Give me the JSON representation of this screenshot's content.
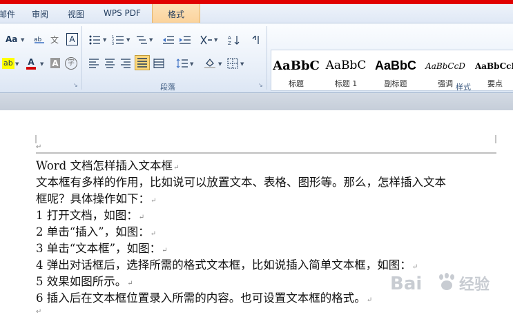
{
  "tabs": [
    "邮件",
    "审阅",
    "视图",
    "WPS PDF",
    "格式"
  ],
  "font_group": {
    "change_case_label": "Aa",
    "char_border_label": "A",
    "highlight_label": "ab",
    "font_color_label": "A",
    "shading_label": "A",
    "enclose_char_label": "字"
  },
  "paragraph_group": {
    "label": "段落",
    "active_alignment": "justify"
  },
  "styles_group": {
    "label": "样式",
    "items": [
      {
        "preview": "AaBbC",
        "name": "标题"
      },
      {
        "preview": "AaBbC",
        "name": "标题 1"
      },
      {
        "preview": "AaBbC",
        "name": "副标题"
      },
      {
        "preview": "AaBbCcD",
        "name": "强调"
      },
      {
        "preview": "AaBbCcI",
        "name": "要点"
      }
    ]
  },
  "document": {
    "header_mark": "↵",
    "lines": [
      "Word 文档怎样插入文本框",
      "文本框有多样的作用，比如说可以放置文本、表格、图形等。那么，怎样插入文本",
      "框呢？具体操作如下：",
      "1 打开文档，如图：",
      "2 单击“插入”，如图：",
      "3 单击“文本框”，如图：",
      "4 弹出对话框后，选择所需的格式文本框，比如说插入简单文本框，如图：",
      "5 效果如图所示。",
      "6 插入后在文本框位置录入所需的内容。也可设置文本框的格式。"
    ],
    "paragraph_mark": "↵",
    "end_mark": "↵"
  },
  "watermark": {
    "text": "Bai",
    "suffix": "经验"
  },
  "colors": {
    "accent_red": "#e10000",
    "highlight_yellow": "#ffff00",
    "font_red": "#d40000",
    "selected_button": "#fcd77a"
  }
}
